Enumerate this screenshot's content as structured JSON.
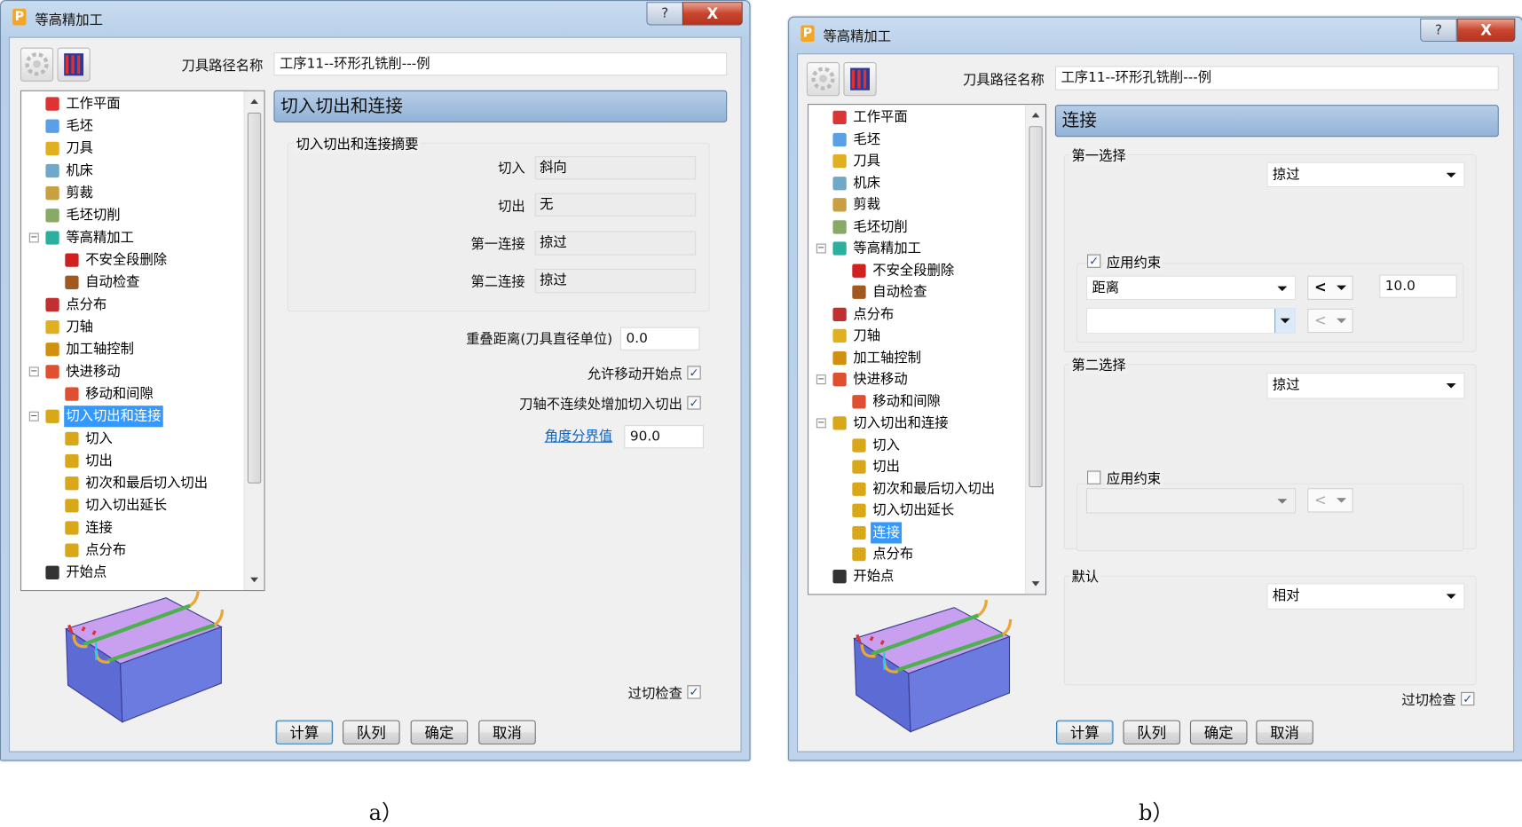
{
  "tree_items": [
    {
      "label": "工作平面",
      "level": 1,
      "icon": "workplane-icon",
      "color": "#d33"
    },
    {
      "label": "毛坯",
      "level": 1,
      "icon": "block-icon",
      "color": "#5aa0e6"
    },
    {
      "label": "刀具",
      "level": 1,
      "icon": "tool-icon",
      "color": "#e0b020"
    },
    {
      "label": "机床",
      "level": 1,
      "icon": "machine-icon",
      "color": "#6fa8c8"
    },
    {
      "label": "剪裁",
      "level": 1,
      "icon": "trim-icon",
      "color": "#c8a040"
    },
    {
      "label": "毛坯切削",
      "level": 1,
      "icon": "stock-cut-icon",
      "color": "#8a6"
    },
    {
      "label": "等高精加工",
      "level": 0,
      "icon": "constant-z-icon",
      "color": "#2bb0a0",
      "expander": "−"
    },
    {
      "label": "不安全段删除",
      "level": 2,
      "icon": "unsafe-segment-icon",
      "color": "#d02020"
    },
    {
      "label": "自动检查",
      "level": 2,
      "icon": "auto-check-icon",
      "color": "#a05a20"
    },
    {
      "label": "点分布",
      "level": 1,
      "icon": "point-distribution-icon",
      "color": "#c03030"
    },
    {
      "label": "刀轴",
      "level": 1,
      "icon": "tool-axis-icon",
      "color": "#e0b020"
    },
    {
      "label": "加工轴控制",
      "level": 1,
      "icon": "axis-control-icon",
      "color": "#d09010"
    },
    {
      "label": "快进移动",
      "level": 0,
      "icon": "rapid-move-icon",
      "color": "#e05030",
      "expander": "−"
    },
    {
      "label": "移动和间隙",
      "level": 2,
      "icon": "moves-clearance-icon",
      "color": "#e05030"
    },
    {
      "label": "切入切出和连接",
      "level": 0,
      "icon": "leads-links-icon",
      "color": "#d8a818",
      "expander": "−"
    },
    {
      "label": "切入",
      "level": 2,
      "icon": "lead-in-icon",
      "color": "#d8a818"
    },
    {
      "label": "切出",
      "level": 2,
      "icon": "lead-out-icon",
      "color": "#d8a818"
    },
    {
      "label": "初次和最后切入切出",
      "level": 2,
      "icon": "first-last-lead-icon",
      "color": "#d8a818"
    },
    {
      "label": "切入切出延长",
      "level": 2,
      "icon": "lead-extension-icon",
      "color": "#d8a818"
    },
    {
      "label": "连接",
      "level": 2,
      "icon": "links-icon",
      "color": "#d8a818"
    },
    {
      "label": "点分布",
      "level": 2,
      "icon": "point-distribution-icon",
      "color": "#d8a818"
    },
    {
      "label": "开始点",
      "level": 1,
      "icon": "start-point-icon",
      "color": "#333"
    }
  ],
  "dialog_a": {
    "title": "等高精加工",
    "help": "?",
    "close": "X",
    "toolpath_name_label": "刀具路径名称",
    "toolpath_name": "工序11--环形孔铣削---例",
    "selected_tree_index": 14,
    "section_title": "切入切出和连接",
    "summary": {
      "title": "切入切出和连接摘要",
      "rows": [
        {
          "label": "切入",
          "value": "斜向"
        },
        {
          "label": "切出",
          "value": "无"
        },
        {
          "label": "第一连接",
          "value": "掠过"
        },
        {
          "label": "第二连接",
          "value": "掠过"
        }
      ]
    },
    "overlap_label": "重叠距离(刀具直径单位)",
    "overlap_value": "0.0",
    "allow_move_start_label": "允许移动开始点",
    "allow_move_start_checked": true,
    "add_leads_label": "刀轴不连续处增加切入切出",
    "add_leads_checked": true,
    "angle_link": "角度分界值",
    "angle_value": "90.0",
    "gouge_check_label": "过切检查",
    "gouge_check_checked": true,
    "buttons": {
      "calculate": "计算",
      "queue": "队列",
      "ok": "确定",
      "cancel": "取消"
    },
    "caption": "a）"
  },
  "dialog_b": {
    "title": "等高精加工",
    "help": "?",
    "close": "X",
    "toolpath_name_label": "刀具路径名称",
    "toolpath_name": "工序11--环形孔铣削---例",
    "selected_tree_index": 19,
    "section_title": "连接",
    "first_choice": {
      "label": "第一选择",
      "value": "掠过",
      "constraint_label": "应用约束",
      "constraint_checked": true,
      "constraint_type": "距离",
      "operator": "<",
      "constraint_value": "10.0",
      "second_type": "",
      "second_operator": "<"
    },
    "second_choice": {
      "label": "第二选择",
      "value": "掠过",
      "constraint_label": "应用约束",
      "constraint_checked": false,
      "constraint_type": "",
      "operator": "<"
    },
    "default": {
      "label": "默认",
      "value": "相对"
    },
    "gouge_check_label": "过切检查",
    "gouge_check_checked": true,
    "buttons": {
      "calculate": "计算",
      "queue": "队列",
      "ok": "确定",
      "cancel": "取消"
    },
    "caption": "b）"
  }
}
